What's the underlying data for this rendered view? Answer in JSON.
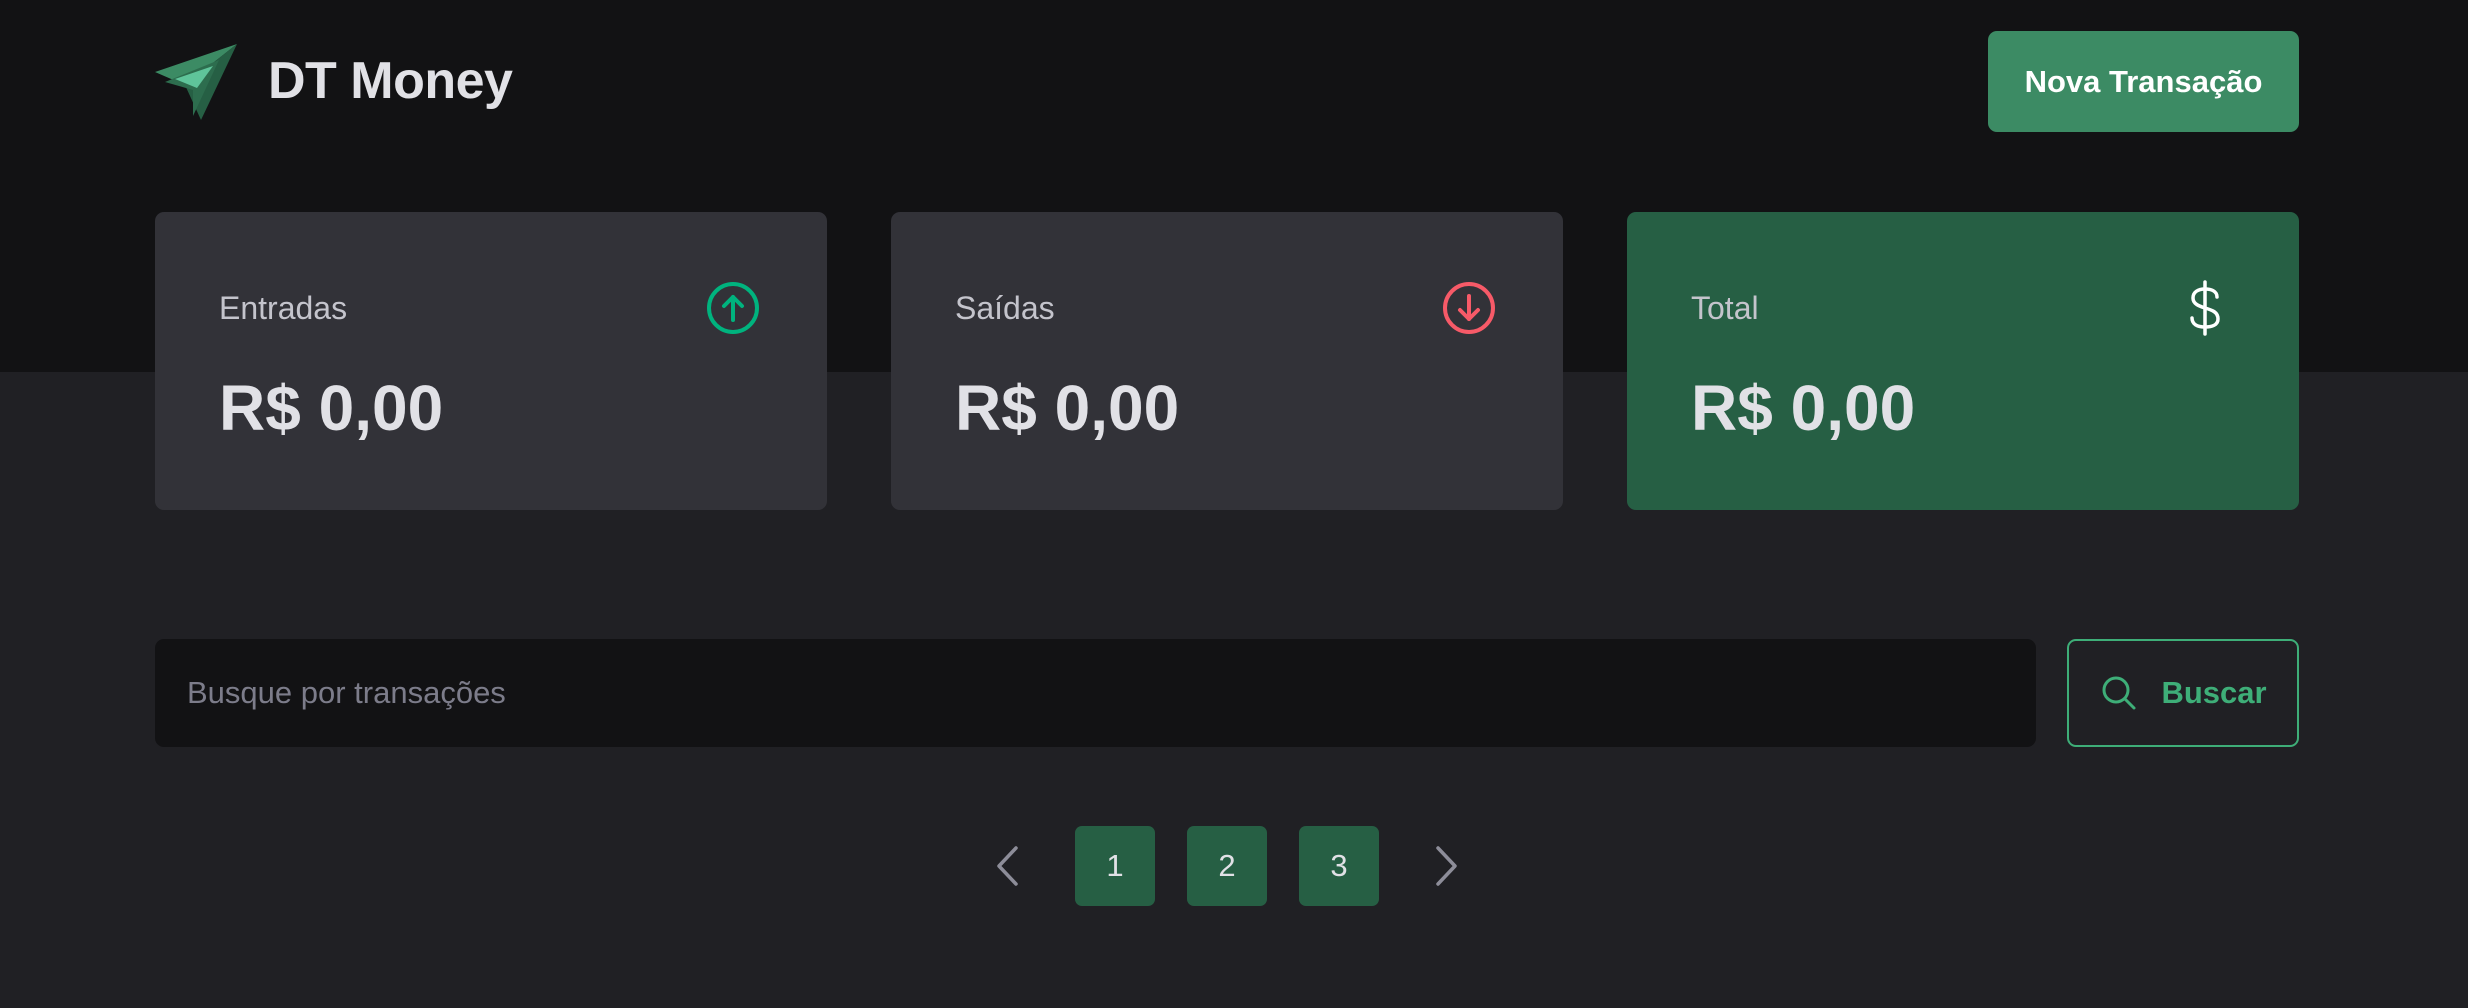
{
  "header": {
    "brand": "DT Money",
    "new_transaction_label": "Nova Transação"
  },
  "summary": {
    "income": {
      "label": "Entradas",
      "value": "R$ 0,00",
      "icon": "arrow-circle-up-icon",
      "color": "#00b37e"
    },
    "outcome": {
      "label": "Saídas",
      "value": "R$ 0,00",
      "icon": "arrow-circle-down-icon",
      "color": "#f75a68"
    },
    "total": {
      "label": "Total",
      "value": "R$ 0,00",
      "icon": "currency-dollar-icon",
      "color": "#ffffff"
    }
  },
  "search": {
    "placeholder": "Busque por transações",
    "value": "",
    "button_label": "Buscar"
  },
  "pagination": {
    "pages": [
      "1",
      "2",
      "3"
    ]
  },
  "colors": {
    "accent": "#3c8b64",
    "accent_light": "#3eae78",
    "income": "#00b37e",
    "outcome": "#f75a68"
  }
}
